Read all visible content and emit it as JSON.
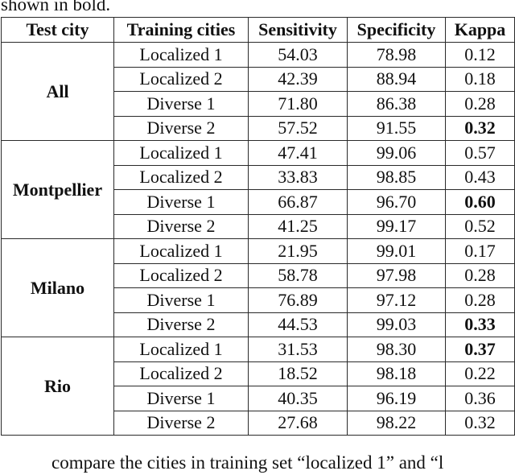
{
  "caption_top": "shown in bold.",
  "table": {
    "headers": [
      "Test city",
      "Training cities",
      "Sensitivity",
      "Specificity",
      "Kappa"
    ],
    "groups": [
      {
        "test_city": "All",
        "rows": [
          {
            "training": "Localized 1",
            "sensitivity": "54.03",
            "specificity": "78.98",
            "kappa": "0.12",
            "kappa_bold": false
          },
          {
            "training": "Localized 2",
            "sensitivity": "42.39",
            "specificity": "88.94",
            "kappa": "0.18",
            "kappa_bold": false
          },
          {
            "training": "Diverse 1",
            "sensitivity": "71.80",
            "specificity": "86.38",
            "kappa": "0.28",
            "kappa_bold": false
          },
          {
            "training": "Diverse 2",
            "sensitivity": "57.52",
            "specificity": "91.55",
            "kappa": "0.32",
            "kappa_bold": true
          }
        ]
      },
      {
        "test_city": "Montpellier",
        "rows": [
          {
            "training": "Localized 1",
            "sensitivity": "47.41",
            "specificity": "99.06",
            "kappa": "0.57",
            "kappa_bold": false
          },
          {
            "training": "Localized 2",
            "sensitivity": "33.83",
            "specificity": "98.85",
            "kappa": "0.43",
            "kappa_bold": false
          },
          {
            "training": "Diverse 1",
            "sensitivity": "66.87",
            "specificity": "96.70",
            "kappa": "0.60",
            "kappa_bold": true
          },
          {
            "training": "Diverse 2",
            "sensitivity": "41.25",
            "specificity": "99.17",
            "kappa": "0.52",
            "kappa_bold": false
          }
        ]
      },
      {
        "test_city": "Milano",
        "rows": [
          {
            "training": "Localized 1",
            "sensitivity": "21.95",
            "specificity": "99.01",
            "kappa": "0.17",
            "kappa_bold": false
          },
          {
            "training": "Localized 2",
            "sensitivity": "58.78",
            "specificity": "97.98",
            "kappa": "0.28",
            "kappa_bold": false
          },
          {
            "training": "Diverse 1",
            "sensitivity": "76.89",
            "specificity": "97.12",
            "kappa": "0.28",
            "kappa_bold": false
          },
          {
            "training": "Diverse 2",
            "sensitivity": "44.53",
            "specificity": "99.03",
            "kappa": "0.33",
            "kappa_bold": true
          }
        ]
      },
      {
        "test_city": "Rio",
        "rows": [
          {
            "training": "Localized 1",
            "sensitivity": "31.53",
            "specificity": "98.30",
            "kappa": "0.37",
            "kappa_bold": true
          },
          {
            "training": "Localized 2",
            "sensitivity": "18.52",
            "specificity": "98.18",
            "kappa": "0.22",
            "kappa_bold": false
          },
          {
            "training": "Diverse 1",
            "sensitivity": "40.35",
            "specificity": "96.19",
            "kappa": "0.36",
            "kappa_bold": false
          },
          {
            "training": "Diverse 2",
            "sensitivity": "27.68",
            "specificity": "98.22",
            "kappa": "0.32",
            "kappa_bold": false
          }
        ]
      }
    ]
  },
  "caption_bottom": "compare the cities in training set “localized 1” and “l"
}
